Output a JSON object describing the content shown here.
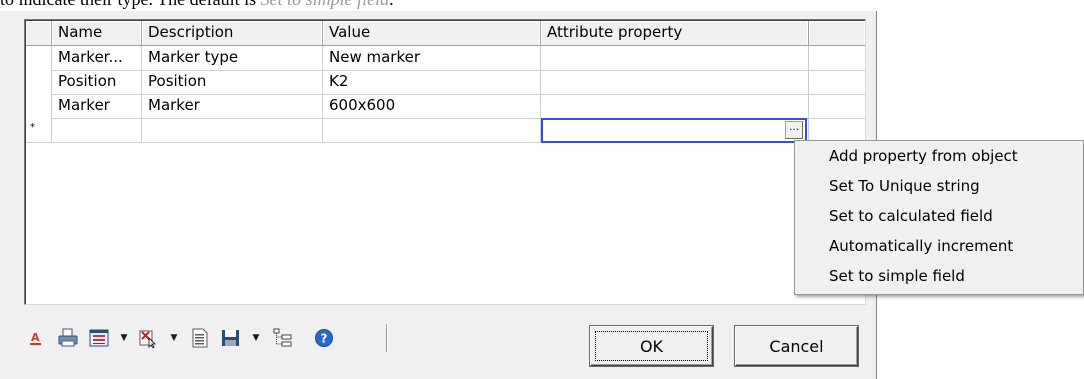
{
  "caption": {
    "text": "to indicate their type. The default is ",
    "italic": "Set to simple field",
    "tail": "."
  },
  "grid": {
    "columns": [
      "Name",
      "Description",
      "Value",
      "Attribute property"
    ],
    "rows": [
      {
        "name": "Marker...",
        "description": "Marker type",
        "value": "New marker",
        "attribute": ""
      },
      {
        "name": "Position",
        "description": "Position",
        "value": "K2",
        "attribute": ""
      },
      {
        "name": "Marker",
        "description": "Marker",
        "value": "600x600",
        "attribute": ""
      }
    ],
    "new_row_marker": "*",
    "ellipsis": "..."
  },
  "context_menu": {
    "items": [
      "Add property from object",
      "Set To Unique string",
      "Set to calculated field",
      "Automatically increment",
      "Set to simple field"
    ]
  },
  "toolbar": {
    "icons": [
      "font-color-icon",
      "print-icon",
      "view-icon",
      "delete-icon",
      "document-icon",
      "save-icon",
      "tree-icon",
      "help-icon"
    ]
  },
  "buttons": {
    "ok": "OK",
    "cancel": "Cancel"
  },
  "colors": {
    "dialog_bg": "#f0f0f0",
    "focus_border": "#3a4cd6",
    "help_blue": "#2b66c8"
  }
}
